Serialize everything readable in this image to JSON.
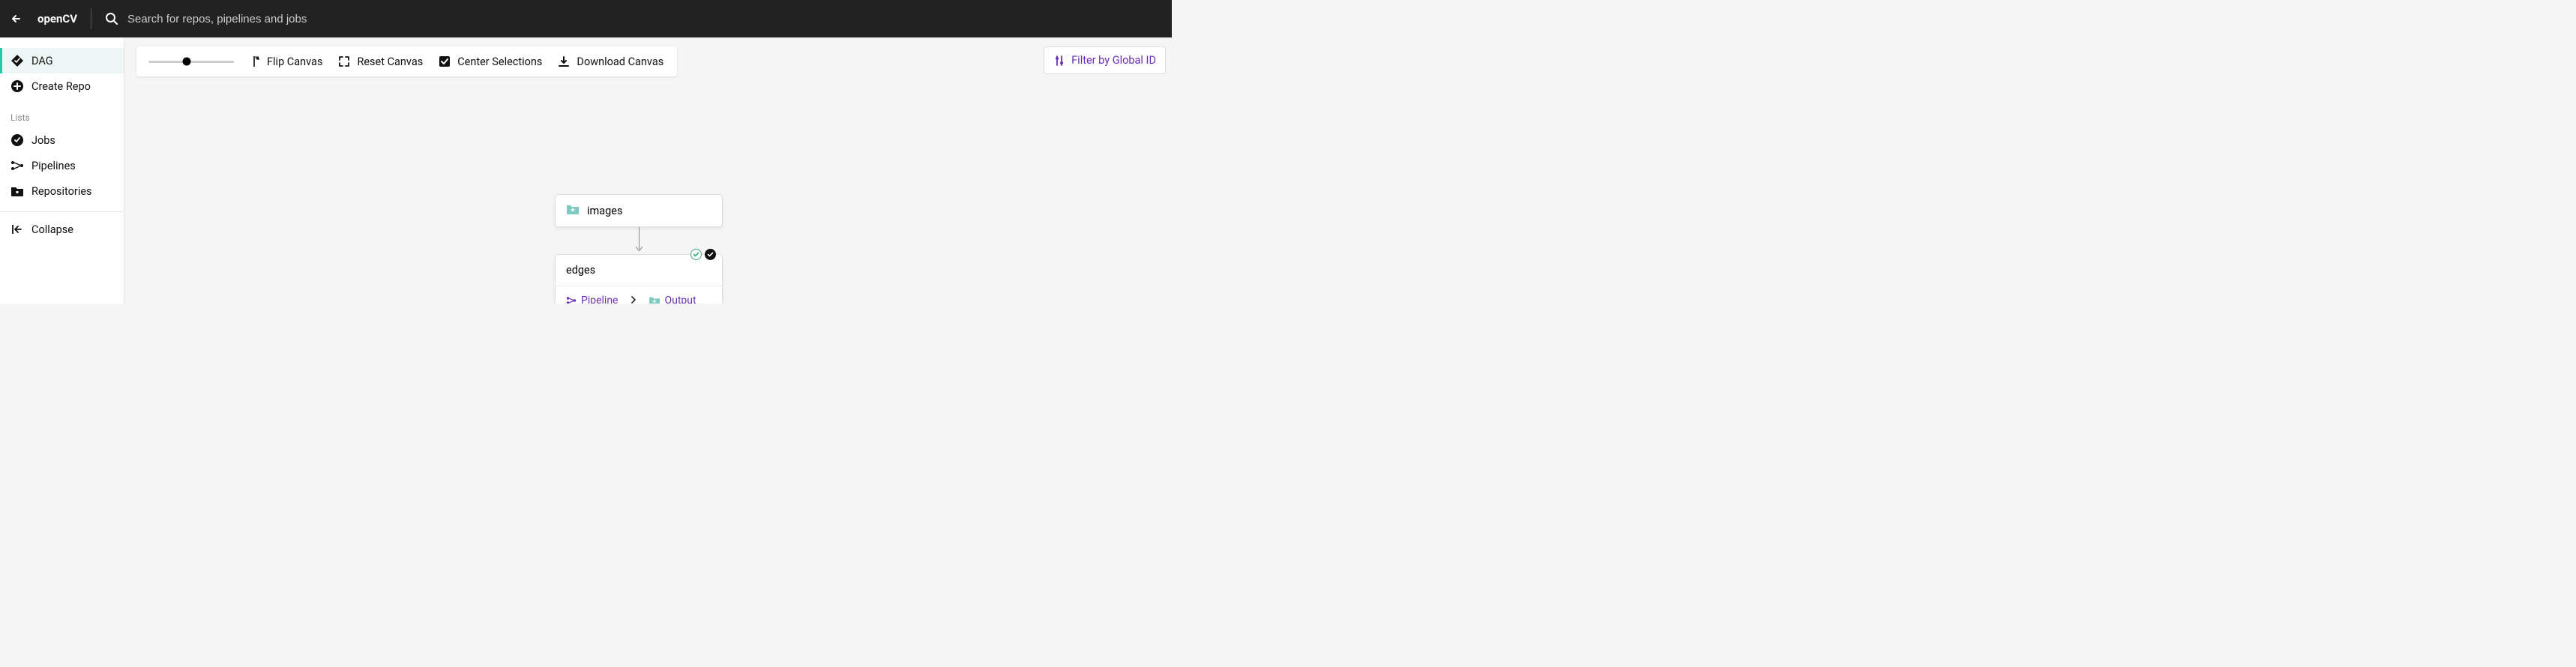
{
  "header": {
    "brand": "openCV",
    "search_placeholder": "Search for repos, pipelines and jobs"
  },
  "sidebar": {
    "items": [
      {
        "label": "DAG",
        "icon": "dag-icon",
        "active": true
      },
      {
        "label": "Create Repo",
        "icon": "plus-circle-icon",
        "active": false
      }
    ],
    "lists_header": "Lists",
    "lists": [
      {
        "label": "Jobs",
        "icon": "jobs-icon"
      },
      {
        "label": "Pipelines",
        "icon": "pipelines-icon"
      },
      {
        "label": "Repositories",
        "icon": "repositories-icon"
      }
    ],
    "collapse_label": "Collapse"
  },
  "toolbar": {
    "flip_label": "Flip Canvas",
    "reset_label": "Reset Canvas",
    "center_label": "Center Selections",
    "download_label": "Download Canvas"
  },
  "filter": {
    "label": "Filter by Global ID"
  },
  "dag": {
    "repo_node": {
      "name": "images"
    },
    "pipeline_node": {
      "name": "edges",
      "pipeline_label": "Pipeline",
      "output_label": "Output",
      "status": "success"
    }
  }
}
